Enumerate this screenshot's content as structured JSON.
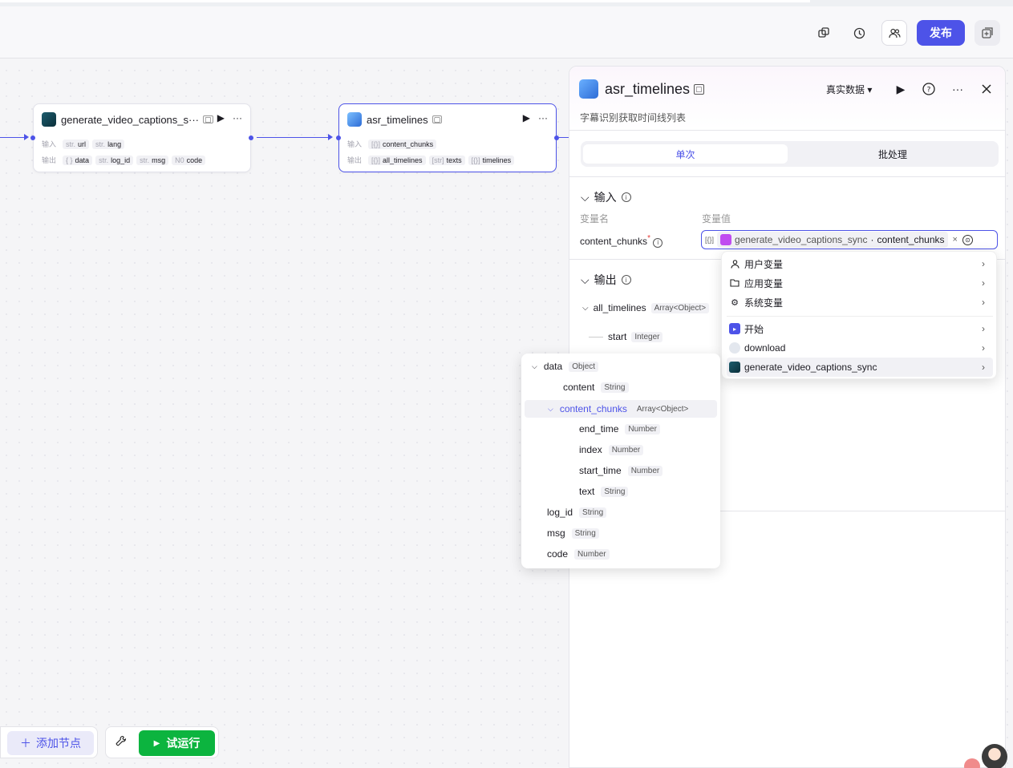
{
  "header": {
    "publish_label": "发布"
  },
  "nodes": {
    "gen": {
      "title": "generate_video_captions_s···",
      "input_label": "输入",
      "output_label": "输出",
      "inputs": [
        {
          "type": "str.",
          "name": "url"
        },
        {
          "type": "str.",
          "name": "lang"
        }
      ],
      "outputs": [
        {
          "type": "{ }",
          "name": "data"
        },
        {
          "type": "str.",
          "name": "log_id"
        },
        {
          "type": "str.",
          "name": "msg"
        },
        {
          "type": "N0",
          "name": "code"
        }
      ]
    },
    "asr": {
      "title": "asr_timelines",
      "input_label": "输入",
      "output_label": "输出",
      "inputs": [
        {
          "type": "[{}]",
          "name": "content_chunks"
        }
      ],
      "outputs": [
        {
          "type": "[{}]",
          "name": "all_timelines"
        },
        {
          "type": "[str]",
          "name": "texts"
        },
        {
          "type": "[{}]",
          "name": "timelines"
        }
      ]
    }
  },
  "panel": {
    "title": "asr_timelines",
    "description": "字幕识别获取时间线列表",
    "data_mode": "真实数据",
    "tabs": [
      "单次",
      "批处理"
    ],
    "input_section": "输入",
    "col_name": "变量名",
    "col_value": "变量值",
    "input_var": "content_chunks",
    "ref_node": "generate_video_captions_sync",
    "ref_sep": "·",
    "ref_field": "content_chunks",
    "output_section": "输出",
    "outputs": [
      {
        "name": "all_timelines",
        "type": "Array<Object>"
      },
      {
        "name": "start",
        "type": "Integer"
      }
    ]
  },
  "menu": {
    "items": [
      {
        "label": "用户变量",
        "icon": "user-icon"
      },
      {
        "label": "应用变量",
        "icon": "folder-icon"
      },
      {
        "label": "系统变量",
        "icon": "gear-icon"
      },
      {
        "label": "开始",
        "icon": "start-icon"
      },
      {
        "label": "download",
        "icon": "download-icon"
      },
      {
        "label": "generate_video_captions_sync",
        "icon": "plugin-icon"
      }
    ]
  },
  "submenu": {
    "items": [
      {
        "name": "data",
        "type": "Object"
      },
      {
        "name": "content",
        "type": "String"
      },
      {
        "name": "content_chunks",
        "type": "Array<Object>"
      },
      {
        "name": "end_time",
        "type": "Number"
      },
      {
        "name": "index",
        "type": "Number"
      },
      {
        "name": "start_time",
        "type": "Number"
      },
      {
        "name": "text",
        "type": "String"
      },
      {
        "name": "log_id",
        "type": "String"
      },
      {
        "name": "msg",
        "type": "String"
      },
      {
        "name": "code",
        "type": "Number"
      }
    ]
  },
  "toolbar": {
    "add_node": "添加节点",
    "test_run": "试运行"
  }
}
